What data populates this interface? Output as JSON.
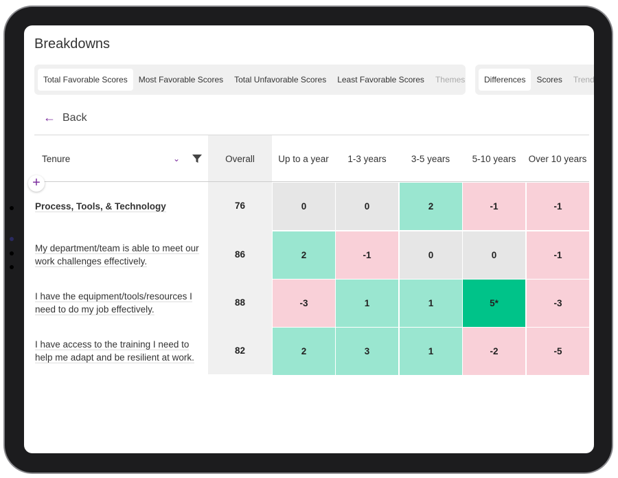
{
  "title": "Breakdowns",
  "tabs_left": [
    {
      "label": "Total Favorable Scores",
      "active": true
    },
    {
      "label": "Most Favorable Scores"
    },
    {
      "label": "Total Unfavorable Scores"
    },
    {
      "label": "Least Favorable Scores"
    },
    {
      "label": "Themes",
      "disabled": true
    }
  ],
  "tabs_right": [
    {
      "label": "Differences",
      "active": true
    },
    {
      "label": "Scores"
    },
    {
      "label": "Trend",
      "disabled": true
    }
  ],
  "back_label": "Back",
  "table": {
    "group_label": "Tenure",
    "columns": [
      "Overall",
      "Up to a year",
      "1-3 years",
      "3-5 years",
      "5-10 years",
      "Over 10 years"
    ],
    "rows": [
      {
        "label": "Process, Tools, & Technology",
        "overall": "76",
        "values": [
          "0",
          "0",
          "2",
          "-1",
          "-1"
        ],
        "status": [
          "neutral",
          "neutral",
          "fav",
          "unfav",
          "unfav"
        ]
      },
      {
        "label": "My department/team is able to meet our work challenges effectively.",
        "overall": "86",
        "values": [
          "2",
          "-1",
          "0",
          "0",
          "-1"
        ],
        "status": [
          "fav",
          "unfav",
          "neutral",
          "neutral",
          "unfav"
        ]
      },
      {
        "label": "I have the equipment/tools/resources I need to do my job effectively.",
        "overall": "88",
        "values": [
          "-3",
          "1",
          "1",
          "5*",
          "-3"
        ],
        "status": [
          "unfav",
          "fav",
          "fav",
          "sig",
          "unfav"
        ]
      },
      {
        "label": "I have access to the training I need to help me adapt and be resilient at work.",
        "overall": "82",
        "values": [
          "2",
          "3",
          "1",
          "-2",
          "-5"
        ],
        "status": [
          "fav",
          "fav",
          "fav",
          "unfav",
          "unfav"
        ]
      }
    ]
  },
  "colors": {
    "accent": "#7b2d9e",
    "neutral": "#e6e6e6",
    "favorable": "#9ae6d0",
    "unfavorable": "#f9d0d8",
    "significant": "#00c389"
  }
}
